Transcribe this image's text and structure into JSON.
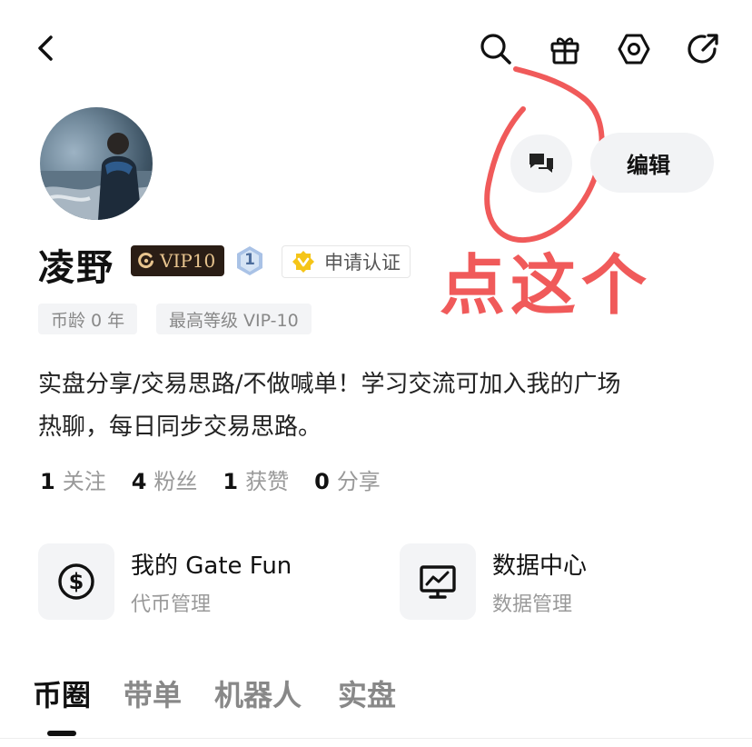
{
  "header": {
    "back_icon": "chevron-left-icon",
    "actions": [
      "search-icon",
      "gift-icon",
      "settings-icon",
      "share-icon"
    ]
  },
  "profile": {
    "name": "凌野",
    "vip_label": "VIP10",
    "level_value": "1",
    "cert_label": "申请认证",
    "tags": [
      "币龄 0 年",
      "最高等级 VIP-10"
    ],
    "edit_label": "编辑",
    "message_icon": "chat-icon",
    "bio_line1": "实盘分享/交易思路/不做喊单！学习交流可加入我的广场",
    "bio_line2": "热聊，每日同步交易思路。"
  },
  "annotation": {
    "text": "点这个",
    "color": "#f05a5a"
  },
  "stats": [
    {
      "value": "1",
      "label": "关注"
    },
    {
      "value": "4",
      "label": "粉丝"
    },
    {
      "value": "1",
      "label": "获赞"
    },
    {
      "value": "0",
      "label": "分享"
    }
  ],
  "features": [
    {
      "title": "我的 Gate Fun",
      "subtitle": "代币管理",
      "icon": "dollar-coin-icon"
    },
    {
      "title": "数据中心",
      "subtitle": "数据管理",
      "icon": "chart-monitor-icon"
    }
  ],
  "tabs": [
    {
      "label": "币圈",
      "active": true
    },
    {
      "label": "带单",
      "active": false
    },
    {
      "label": "机器人",
      "active": false
    },
    {
      "label": "实盘",
      "active": false
    }
  ],
  "colors": {
    "vip_bg": "#2a1d15",
    "vip_text": "#e8c48e",
    "accent_red": "#f05a5a",
    "surface": "#f2f3f5"
  }
}
